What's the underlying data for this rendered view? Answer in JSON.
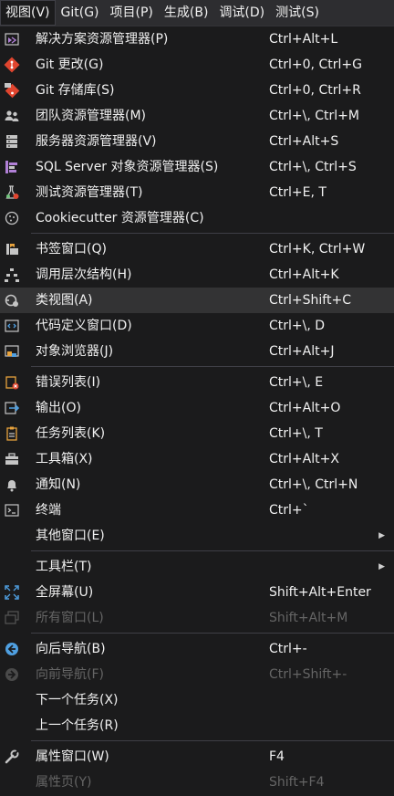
{
  "menubar": {
    "items": [
      "视图(V)",
      "Git(G)",
      "项目(P)",
      "生成(B)",
      "调试(D)",
      "测试(S)"
    ]
  },
  "menu": {
    "items": [
      {
        "label": "解决方案资源管理器(P)",
        "shortcut": "Ctrl+Alt+L",
        "icon": "solution-explorer-icon"
      },
      {
        "label": "Git 更改(G)",
        "shortcut": "Ctrl+0, Ctrl+G",
        "icon": "git-changes-icon"
      },
      {
        "label": "Git 存储库(S)",
        "shortcut": "Ctrl+0, Ctrl+R",
        "icon": "git-repository-icon"
      },
      {
        "label": "团队资源管理器(M)",
        "shortcut": "Ctrl+\\, Ctrl+M",
        "icon": "team-explorer-icon"
      },
      {
        "label": "服务器资源管理器(V)",
        "shortcut": "Ctrl+Alt+S",
        "icon": "server-explorer-icon"
      },
      {
        "label": "SQL Server 对象资源管理器(S)",
        "shortcut": "Ctrl+\\, Ctrl+S",
        "icon": "sql-server-icon"
      },
      {
        "label": "测试资源管理器(T)",
        "shortcut": "Ctrl+E, T",
        "icon": "test-explorer-icon"
      },
      {
        "label": "Cookiecutter 资源管理器(C)",
        "shortcut": "",
        "icon": "cookiecutter-icon"
      },
      {
        "label": "书签窗口(Q)",
        "shortcut": "Ctrl+K, Ctrl+W",
        "icon": "bookmark-icon"
      },
      {
        "label": "调用层次结构(H)",
        "shortcut": "Ctrl+Alt+K",
        "icon": "call-hierarchy-icon"
      },
      {
        "label": "类视图(A)",
        "shortcut": "Ctrl+Shift+C",
        "icon": "class-view-icon"
      },
      {
        "label": "代码定义窗口(D)",
        "shortcut": "Ctrl+\\, D",
        "icon": "code-definition-icon"
      },
      {
        "label": "对象浏览器(J)",
        "shortcut": "Ctrl+Alt+J",
        "icon": "object-browser-icon"
      },
      {
        "label": "错误列表(I)",
        "shortcut": "Ctrl+\\, E",
        "icon": "error-list-icon"
      },
      {
        "label": "输出(O)",
        "shortcut": "Ctrl+Alt+O",
        "icon": "output-icon"
      },
      {
        "label": "任务列表(K)",
        "shortcut": "Ctrl+\\, T",
        "icon": "task-list-icon"
      },
      {
        "label": "工具箱(X)",
        "shortcut": "Ctrl+Alt+X",
        "icon": "toolbox-icon"
      },
      {
        "label": "通知(N)",
        "shortcut": "Ctrl+\\, Ctrl+N",
        "icon": "bell-icon"
      },
      {
        "label": "终端",
        "shortcut": "Ctrl+`",
        "icon": "terminal-icon"
      },
      {
        "label": "其他窗口(E)",
        "shortcut": "",
        "icon": ""
      },
      {
        "label": "工具栏(T)",
        "shortcut": "",
        "icon": ""
      },
      {
        "label": "全屏幕(U)",
        "shortcut": "Shift+Alt+Enter",
        "icon": "fullscreen-icon"
      },
      {
        "label": "所有窗口(L)",
        "shortcut": "Shift+Alt+M",
        "icon": "all-windows-icon"
      },
      {
        "label": "向后导航(B)",
        "shortcut": "Ctrl+-",
        "icon": "navigate-back-icon"
      },
      {
        "label": "向前导航(F)",
        "shortcut": "Ctrl+Shift+-",
        "icon": "navigate-forward-icon"
      },
      {
        "label": "下一个任务(X)",
        "shortcut": "",
        "icon": ""
      },
      {
        "label": "上一个任务(R)",
        "shortcut": "",
        "icon": ""
      },
      {
        "label": "属性窗口(W)",
        "shortcut": "F4",
        "icon": "wrench-icon"
      },
      {
        "label": "属性页(Y)",
        "shortcut": "Shift+F4",
        "icon": ""
      }
    ]
  },
  "colors": {
    "background": "#1b1b1c",
    "menubar": "#2d2d30",
    "highlight": "#333334",
    "text": "#f1f1f1",
    "disabled_text": "#656565",
    "separator": "#3f3f46"
  }
}
